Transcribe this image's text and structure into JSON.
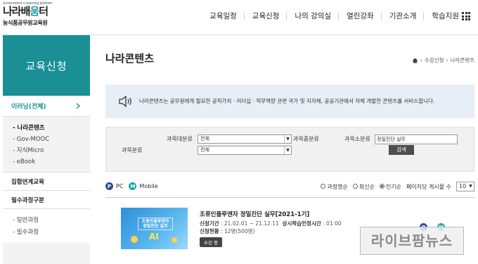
{
  "header": {
    "logo_tagline": "Government e-learning platform",
    "logo_brand_a": "나라배",
    "logo_brand_b": "움",
    "logo_brand_c": "터",
    "org_name": "농식품공무원교육원",
    "nav": [
      "교육일정",
      "교육신청",
      "나의 강의실",
      "열린강좌",
      "기관소개",
      "학습지원"
    ]
  },
  "sidebar": {
    "title": "교육신청",
    "active_item": "이러닝(전체)",
    "sub_items": [
      "나라콘텐츠",
      "Gov-MOOC",
      "지식Micro",
      "eBook"
    ],
    "sections": [
      "집합연계교육",
      "필수과정구분"
    ],
    "sub_items2": [
      "일반과정",
      "필수과정"
    ]
  },
  "page": {
    "title": "나라콘텐츠",
    "breadcrumb": [
      "수강신청",
      "나라콘텐츠"
    ]
  },
  "notice": {
    "text": "나라콘텐츠는 공무원에게 필요한 공직가치 · 리더십 · 직무역량 관련 국가 및 지자체, 공공기관에서 자체 개발한 콘텐츠를 서비스합니다."
  },
  "search": {
    "major_label": "과목대분류",
    "major_value": "전체",
    "middle_label": "과목중분류",
    "minor_label": "과목소분류",
    "minor_value": "정밀진단 실무",
    "category_label": "과목분류",
    "category_value": "전체",
    "button_label": "검색"
  },
  "filters": {
    "pc_label": "PC",
    "mobile_label": "Mobile",
    "sort_options": [
      "과정명순",
      "최신순",
      "인기순"
    ],
    "sort_selected": "인기순",
    "per_page_label": "페이지당 게시물 수",
    "per_page_value": "10"
  },
  "courses": [
    {
      "title": "조류인플루엔자 정밀진단 실무[2021-1기]",
      "period_label": "신청기간",
      "period": ": 21.02.01 ~ 21.12.11",
      "hours_label": "상시학습인정시간",
      "hours": ": 01:00",
      "status_label": "신청현황",
      "status": ": 12명(500명)",
      "badge": "수강 중",
      "thumb_title": "조류인플루엔자 정밀진단 실무",
      "thumb_accent": "AI"
    }
  ],
  "watermark": "라이브팜뉴스",
  "colors": {
    "accent": "#1a8f96",
    "pc": "#2f4a9c",
    "mobile": "#1aa7a0"
  }
}
